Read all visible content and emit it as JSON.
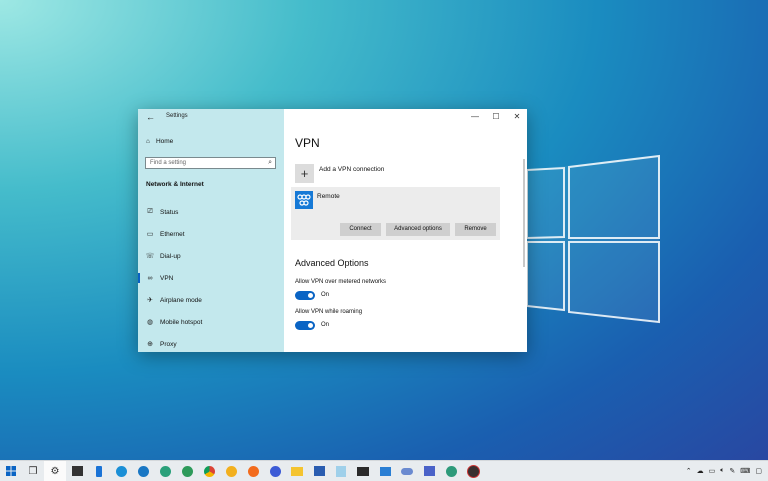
{
  "window": {
    "title": "Settings",
    "minimize_glyph": "—",
    "maximize_glyph": "☐",
    "close_glyph": "✕"
  },
  "sidebar": {
    "home_label": "Home",
    "search_placeholder": "Find a setting",
    "section_title": "Network & Internet",
    "items": [
      {
        "label": "Status",
        "icon": "status-icon",
        "active": false
      },
      {
        "label": "Ethernet",
        "icon": "ethernet-icon",
        "active": false
      },
      {
        "label": "Dial-up",
        "icon": "dialup-icon",
        "active": false
      },
      {
        "label": "VPN",
        "icon": "vpn-icon",
        "active": true
      },
      {
        "label": "Airplane mode",
        "icon": "airplane-icon",
        "active": false
      },
      {
        "label": "Mobile hotspot",
        "icon": "hotspot-icon",
        "active": false
      },
      {
        "label": "Proxy",
        "icon": "globe-icon",
        "active": false
      }
    ]
  },
  "main": {
    "title": "VPN",
    "add_label": "Add a VPN connection",
    "connection": {
      "name": "Remote",
      "connect_label": "Connect",
      "advanced_label": "Advanced options",
      "remove_label": "Remove"
    },
    "advanced_title": "Advanced Options",
    "options": [
      {
        "label": "Allow VPN over metered networks",
        "state": "On"
      },
      {
        "label": "Allow VPN while roaming",
        "state": "On"
      }
    ]
  },
  "colors": {
    "accent": "#0a64c4",
    "sidebar_bg": "#bee6ec",
    "vpn_icon": "#1679d6"
  },
  "taskbar": {
    "apps": [
      "start-icon",
      "task-view-icon",
      "settings-icon",
      "store-icon",
      "phone-icon",
      "edge-icon",
      "edge-beta-icon",
      "edge-dev-icon",
      "edge-canary-icon",
      "chrome-icon",
      "chrome-canary-icon",
      "firefox-icon",
      "firefox-nightly-icon",
      "file-explorer-icon",
      "powershell-icon",
      "notepad-icon",
      "terminal-icon",
      "photos-icon",
      "onedrive-icon",
      "paint-icon",
      "edge-insider-icon",
      "obs-icon"
    ],
    "tray": [
      "chevron-up-icon",
      "onedrive-tray-icon",
      "network-icon",
      "volume-icon",
      "pen-icon",
      "keyboard-icon",
      "notification-icon"
    ]
  }
}
